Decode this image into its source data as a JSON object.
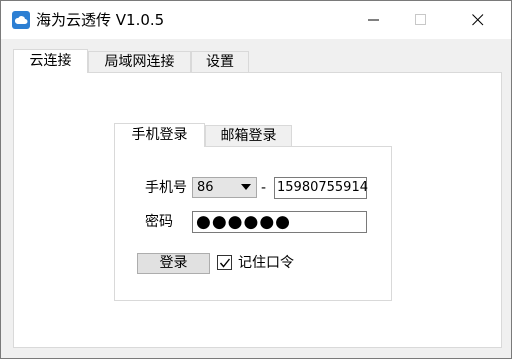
{
  "window": {
    "title": "海为云透传 V1.0.5",
    "app_icon": "cloud-icon",
    "controls": [
      "minimize-icon",
      "maximize-icon",
      "close-icon"
    ]
  },
  "tabs": [
    {
      "label": "云连接",
      "active": true
    },
    {
      "label": "局域网连接",
      "active": false
    },
    {
      "label": "设置",
      "active": false
    }
  ],
  "login": {
    "tabs": [
      {
        "label": "手机登录",
        "active": true
      },
      {
        "label": "邮箱登录",
        "active": false
      }
    ],
    "phone_label": "手机号",
    "country_code": "86",
    "separator": "-",
    "phone_value": "15980755914",
    "password_label": "密码",
    "password_mask": "●●●●●●",
    "login_button": "登录",
    "remember_label": "记住口令",
    "remember_checked": true
  },
  "colors": {
    "accent": "#2d7fd3",
    "panel_bg": "#ffffff",
    "window_bg": "#f0f0f0"
  }
}
